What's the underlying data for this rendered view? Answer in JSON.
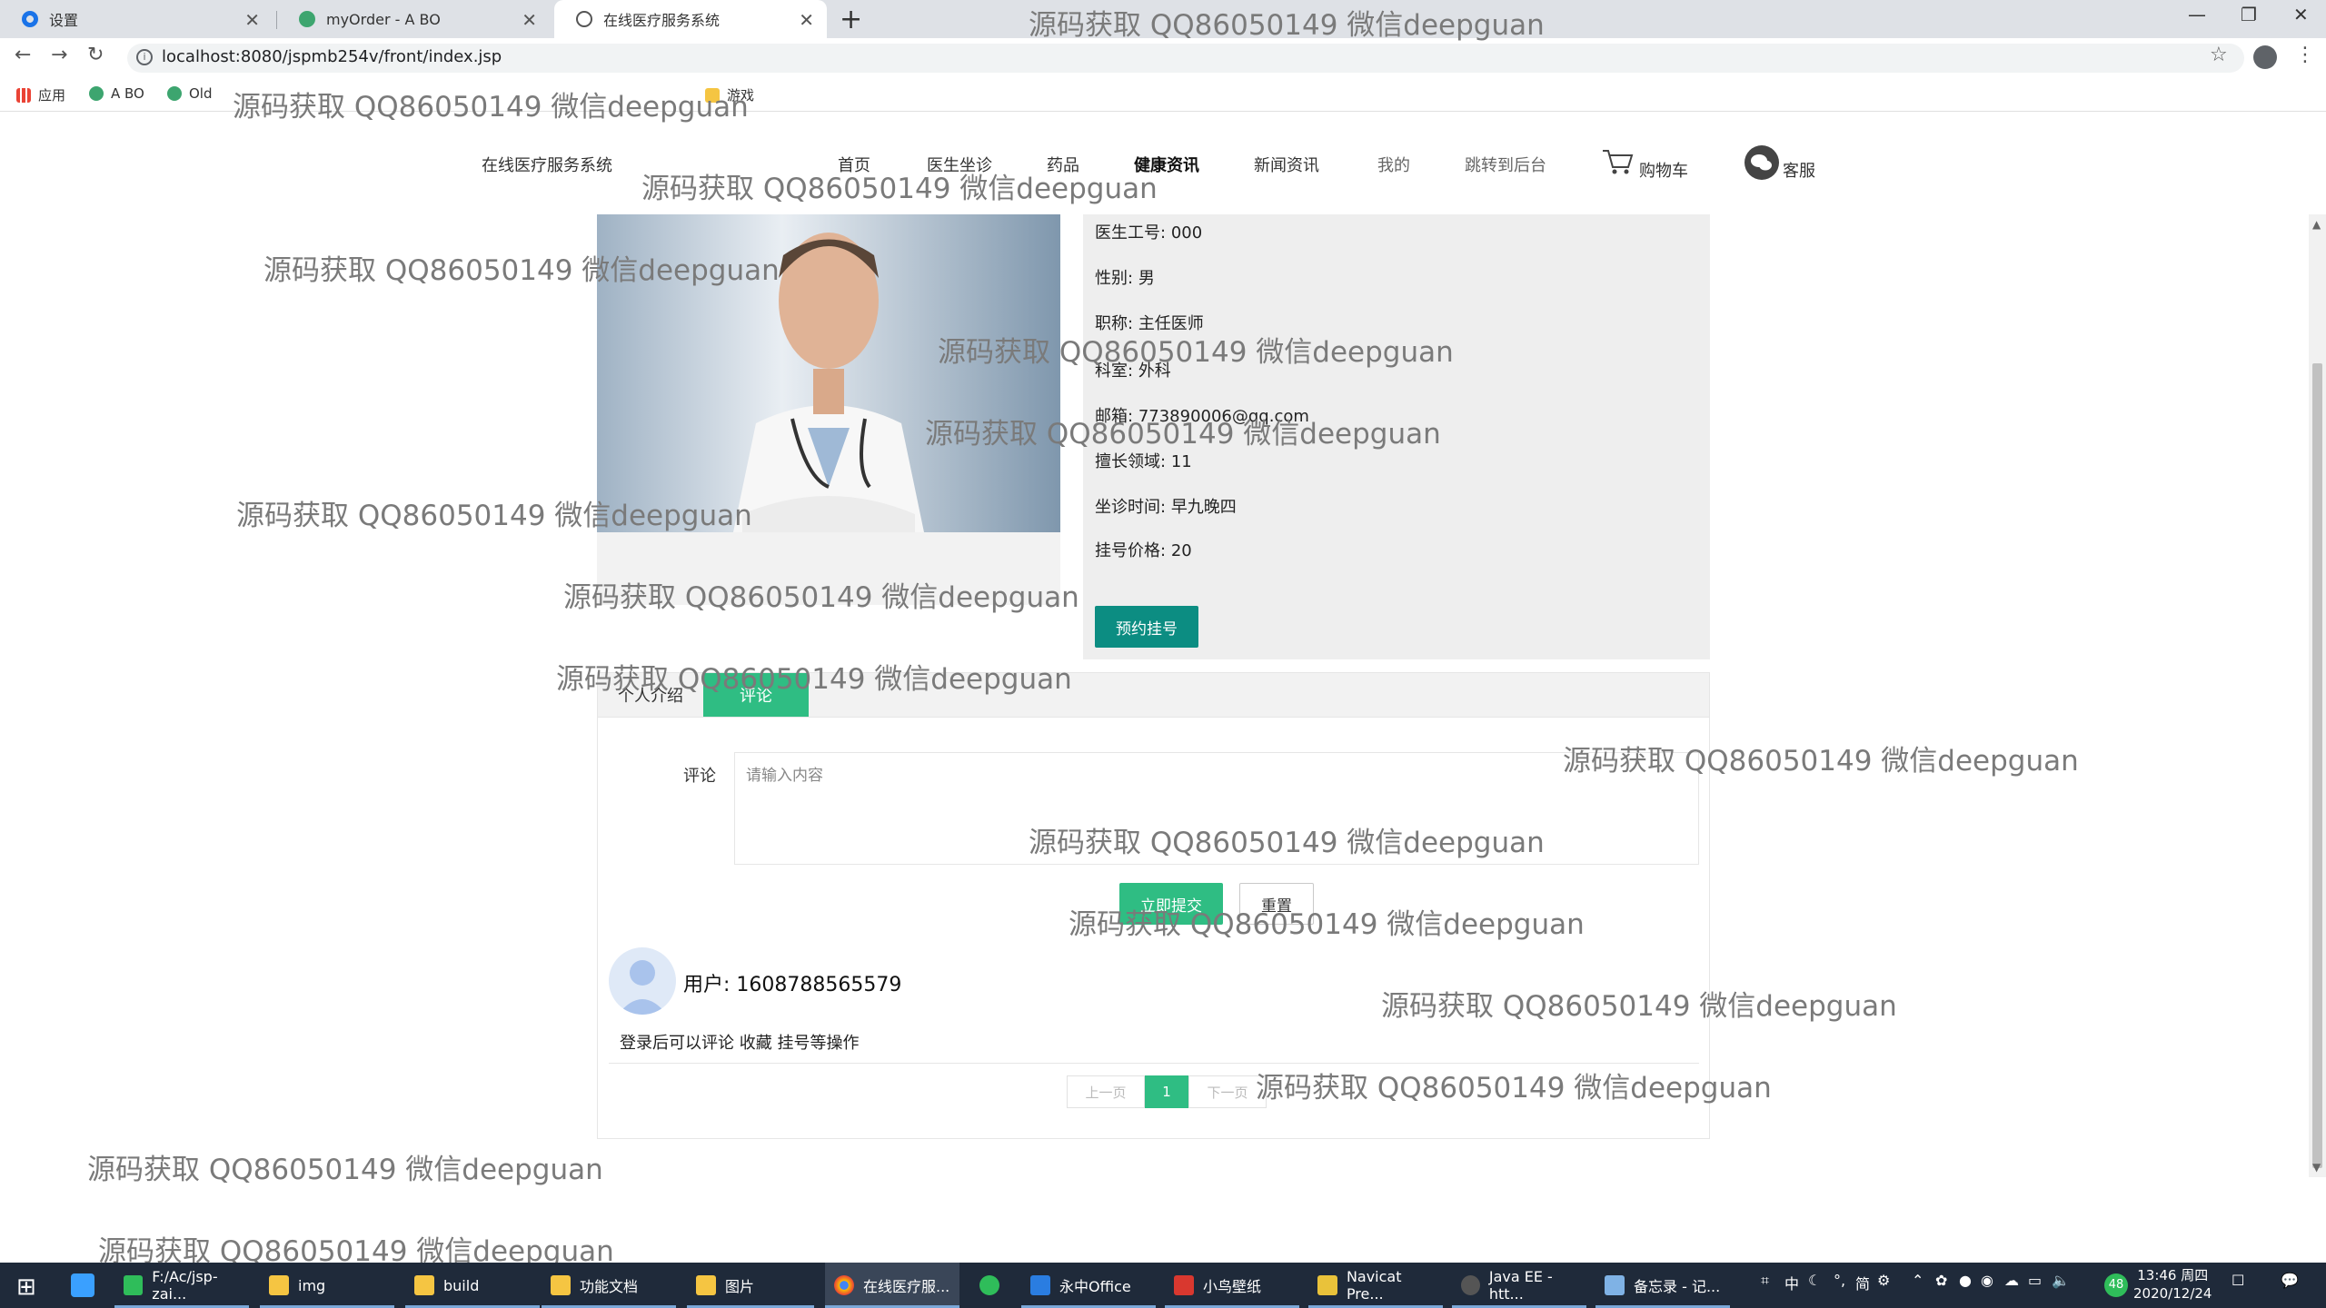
{
  "browser": {
    "tabs": [
      {
        "title": "设置"
      },
      {
        "title": "myOrder - A BO"
      },
      {
        "title": "在线医疗服务系统"
      }
    ],
    "url": "localhost:8080/jspmb254v/front/index.jsp",
    "bookmarks": [
      "应用",
      "A BO",
      "Old",
      "游戏"
    ]
  },
  "site": {
    "brand": "在线医疗服务系统",
    "nav": [
      "首页",
      "医生坐诊",
      "药品",
      "健康资讯",
      "新闻资讯",
      "我的",
      "跳转到后台",
      "购物车",
      "客服"
    ]
  },
  "doctor": {
    "fields": [
      {
        "label": "医生工号:",
        "value": "000"
      },
      {
        "label": "性别:",
        "value": "男"
      },
      {
        "label": "职称:",
        "value": "主任医师"
      },
      {
        "label": "科室:",
        "value": "外科"
      },
      {
        "label": "邮箱:",
        "value": "773890006@qq.com"
      },
      {
        "label": "擅长领域:",
        "value": "11"
      },
      {
        "label": "坐诊时间:",
        "value": "早九晚四"
      },
      {
        "label": "挂号价格:",
        "value": "20"
      }
    ],
    "appointment_button": "预约挂号"
  },
  "detail_tabs": {
    "tabs": [
      "个人介绍",
      "评论"
    ],
    "active": "评论",
    "comment_label": "评论",
    "comment_placeholder": "请输入内容",
    "submit_button": "立即提交",
    "reset_button": "重置"
  },
  "comments": [
    {
      "user": "用户:  1608788565579",
      "content": "登录后可以评论 收藏 挂号等操作"
    }
  ],
  "pagination": {
    "prev": "上一页",
    "current": "1",
    "next": "下一页"
  },
  "watermark": "源码获取 QQ86050149 微信deepguan",
  "taskbar": {
    "items": [
      "F:/Ac/jsp-zai...",
      "img",
      "build",
      "功能文档",
      "图片",
      "在线医疗服...",
      "",
      "永中Office",
      "小鸟壁纸",
      "Navicat Pre...",
      "Java EE - htt...",
      "备忘录 - 记..."
    ],
    "ime": "中",
    "tray_text": "简",
    "badge": "48",
    "time": "13:46 周四",
    "date": "2020/12/24"
  },
  "colors": {
    "primary_green": "#2fbd83",
    "dark_teal": "#0c8d82",
    "panel_gray": "#eeeeee"
  }
}
